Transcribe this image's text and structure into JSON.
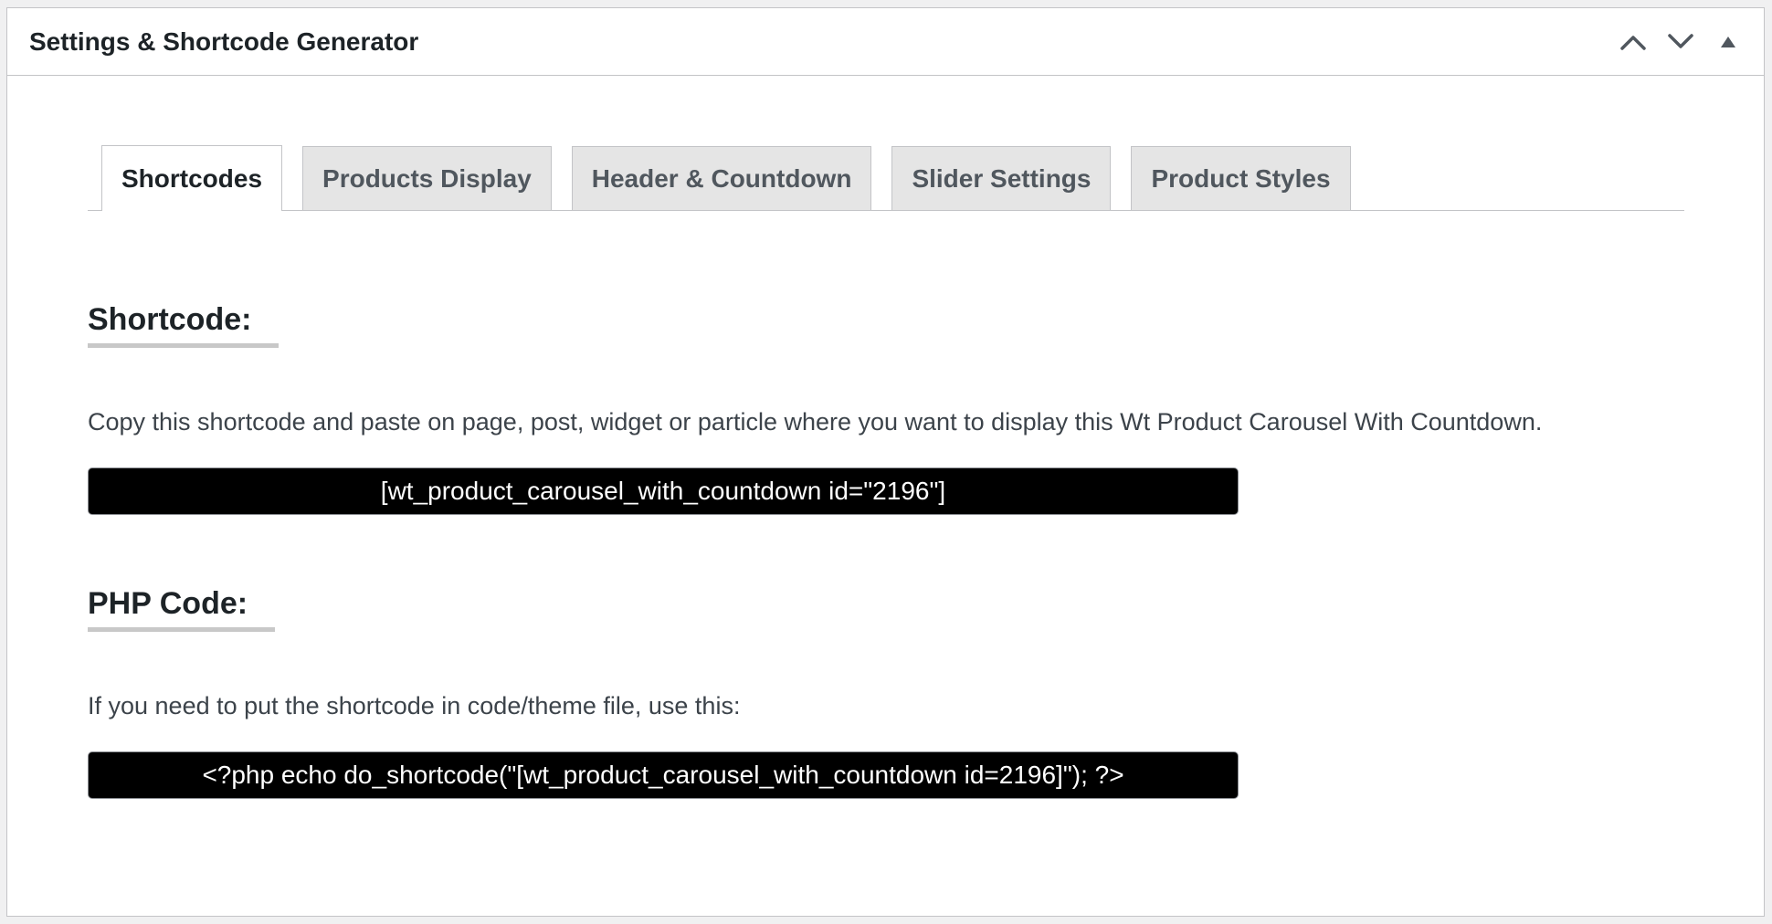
{
  "postbox": {
    "title": "Settings & Shortcode Generator",
    "controls": [
      "chevron-up-icon",
      "chevron-down-icon",
      "triangle-up-icon"
    ]
  },
  "tabs": [
    {
      "label": "Shortcodes",
      "active": true
    },
    {
      "label": "Products Display",
      "active": false
    },
    {
      "label": "Header & Countdown",
      "active": false
    },
    {
      "label": "Slider Settings",
      "active": false
    },
    {
      "label": "Product Styles",
      "active": false
    }
  ],
  "shortcode": {
    "heading": "Shortcode:",
    "description": "Copy this shortcode and paste on page, post, widget or particle where you want to display this Wt Product Carousel With Countdown.",
    "value": "[wt_product_carousel_with_countdown id=\"2196\"]"
  },
  "php": {
    "heading": "PHP Code:",
    "description": "If you need to put the shortcode in code/theme file, use this:",
    "value": "<?php echo do_shortcode(\"[wt_product_carousel_with_countdown id=2196]\"); ?>"
  },
  "colors": {
    "code_bg": "#000000",
    "code_text": "#ffffff",
    "tab_inactive_bg": "#e5e5e5",
    "heading_underline": "#c8c8c8"
  }
}
